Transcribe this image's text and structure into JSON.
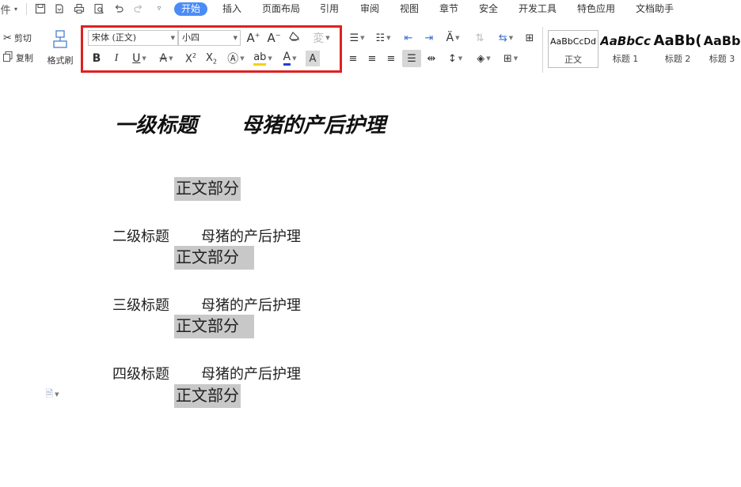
{
  "menubar": {
    "file_fragment": "件",
    "tabs": [
      {
        "label": "开始",
        "active": true
      },
      {
        "label": "插入"
      },
      {
        "label": "页面布局"
      },
      {
        "label": "引用"
      },
      {
        "label": "审阅"
      },
      {
        "label": "视图"
      },
      {
        "label": "章节"
      },
      {
        "label": "安全"
      },
      {
        "label": "开发工具"
      },
      {
        "label": "特色应用"
      },
      {
        "label": "文档助手"
      }
    ]
  },
  "ribbon": {
    "cut_label": "剪切",
    "copy_label": "复制",
    "format_painter_label": "格式刷",
    "font_name": "宋体 (正文)",
    "font_size": "小四",
    "styles": [
      {
        "sample": "AaBbCcDd",
        "name": "正文"
      },
      {
        "sample": "AaBbCc",
        "name": "标题 1"
      },
      {
        "sample": "AaBb(",
        "name": "标题 2"
      },
      {
        "sample": "AaBb",
        "name": "标题 3"
      }
    ],
    "accent_color": "#4a8cf7",
    "highlight_box_color": "#e02020"
  },
  "document": {
    "heading1": {
      "level": "一级标题",
      "title": "母猪的产后护理"
    },
    "body_label": "正文部分",
    "headings": [
      {
        "level": "二级标题",
        "title": "母猪的产后护理"
      },
      {
        "level": "三级标题",
        "title": "母猪的产后护理"
      },
      {
        "level": "四级标题",
        "title": "母猪的产后护理"
      }
    ]
  }
}
